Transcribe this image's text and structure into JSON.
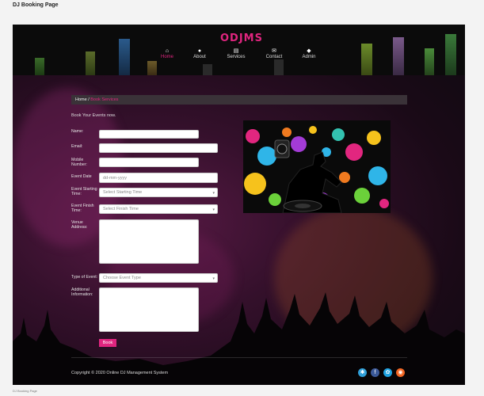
{
  "page": {
    "title": "DJ Booking Page",
    "caption": "DJ Booking Page"
  },
  "header": {
    "logo": "ODJMS",
    "nav": [
      {
        "label": "Home",
        "icon": "home-icon",
        "glyph": "⌂",
        "active": true
      },
      {
        "label": "About",
        "icon": "user-icon",
        "glyph": "●"
      },
      {
        "label": "Services",
        "icon": "list-icon",
        "glyph": "▤"
      },
      {
        "label": "Contact",
        "icon": "envelope-icon",
        "glyph": "✉"
      },
      {
        "label": "Admin",
        "icon": "tag-icon",
        "glyph": "◆"
      }
    ]
  },
  "breadcrumb": {
    "home": "Home",
    "separator": "/",
    "current": "Book Services"
  },
  "form": {
    "intro": "Book Your Events now.",
    "name_label": "Name:",
    "email_label": "Email:",
    "mobile_label": "Mobile Number:",
    "event_date_label": "Event Date",
    "event_date_placeholder": "dd-mm-yyyy",
    "start_label": "Event Starting Time:",
    "start_placeholder": "Select Starting Time",
    "finish_label": "Event Finish Time:",
    "finish_placeholder": "Select Finish Time",
    "venue_label": "Venue Address:",
    "type_label": "Type of Event:",
    "type_placeholder": "Choose Event Type",
    "info_label": "Additional Information:",
    "book_button": "Book"
  },
  "footer": {
    "copyright": "Copyright © 2020 Online DJ Management System",
    "social": [
      {
        "icon": "settings-icon",
        "glyph": "✱",
        "color": "#2f9fd8"
      },
      {
        "icon": "facebook-icon",
        "glyph": "f",
        "color": "#3b5998"
      },
      {
        "icon": "dribbble-icon",
        "glyph": "✿",
        "color": "#1ea1e0"
      },
      {
        "icon": "rss-icon",
        "glyph": "◉",
        "color": "#f26522"
      }
    ]
  },
  "colors": {
    "accent": "#e0257f",
    "background": "#f3f3f3"
  }
}
